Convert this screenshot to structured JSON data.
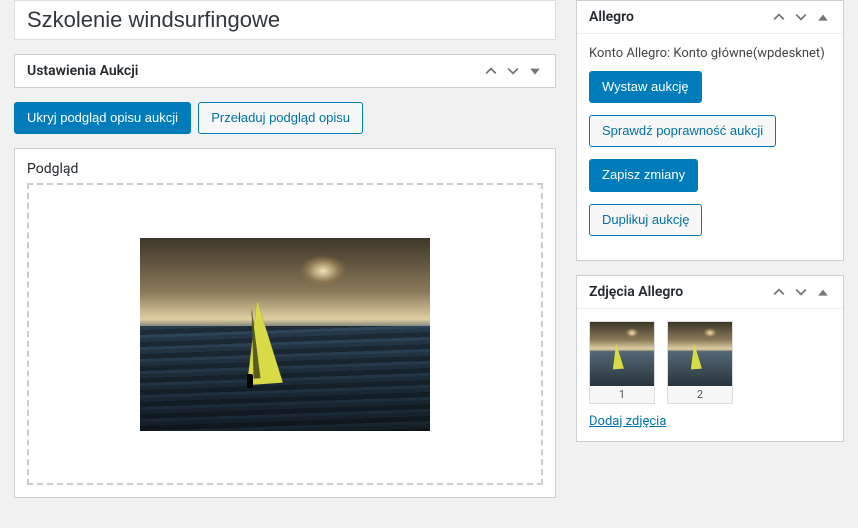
{
  "title_value": "Szkolenie windsurfingowe",
  "settings_panel": {
    "title": "Ustawienia Aukcji"
  },
  "buttons": {
    "hide_preview": "Ukryj podgląd opisu aukcji",
    "reload_preview": "Przeładuj podgląd opisu"
  },
  "preview": {
    "label": "Podgląd"
  },
  "allegro_panel": {
    "title": "Allegro",
    "account_text": "Konto Allegro: Konto główne(wpdesknet)",
    "btn_publish": "Wystaw aukcję",
    "btn_validate": "Sprawdź poprawność aukcji",
    "btn_save": "Zapisz zmiany",
    "btn_duplicate": "Duplikuj aukcję"
  },
  "images_panel": {
    "title": "Zdjęcia Allegro",
    "thumbs": [
      {
        "label": "1"
      },
      {
        "label": "2"
      }
    ],
    "add_link": "Dodaj zdjęcia"
  }
}
